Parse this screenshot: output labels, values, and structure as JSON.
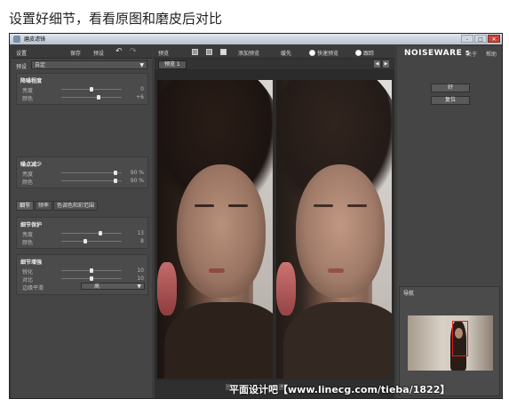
{
  "caption": "设置好细节，看看原图和磨皮后对比",
  "window": {
    "title": "磨皮滤镜",
    "min": "-",
    "max": "□",
    "close": "✕"
  },
  "left_panel": {
    "title": "设置",
    "save": "保存",
    "preset_btn": "预设",
    "undo_icon": "undo-icon",
    "redo_icon": "redo-icon",
    "preset_label": "预设",
    "preset_value": "自定",
    "noise_level": {
      "header": "降噪程度",
      "rows": [
        {
          "name": "亮度",
          "value": "0",
          "level": 0.5
        },
        {
          "name": "颜色",
          "value": "+6",
          "level": 0.62
        }
      ]
    },
    "noise_reduction": {
      "header": "噪点减少",
      "rows": [
        {
          "name": "亮度",
          "value": "90 %",
          "level": 0.9
        },
        {
          "name": "颜色",
          "value": "90 %",
          "level": 0.9
        }
      ]
    },
    "tabs": [
      "细节",
      "频率",
      "色调色和彩范围"
    ],
    "detail_protect": {
      "header": "细节保护",
      "rows": [
        {
          "name": "亮度",
          "value": "13",
          "level": 0.65
        },
        {
          "name": "颜色",
          "value": "8",
          "level": 0.4
        }
      ]
    },
    "detail_enhance": {
      "header": "细节增强",
      "rows": [
        {
          "name": "锐化",
          "value": "10",
          "level": 0.5
        },
        {
          "name": "对比",
          "value": "10",
          "level": 0.5
        }
      ],
      "edge_label": "边缘平滑",
      "edge_value": "高"
    }
  },
  "center_panel": {
    "title": "预览",
    "add_preview": "添加预览",
    "quick_preview": "快速预览",
    "sample": "缓先",
    "track": "跟踪",
    "tab": "预览 1"
  },
  "right_panel": {
    "logo_main": "NOISEWARE",
    "logo_ver": "5",
    "about": "关于",
    "help": "帮助",
    "ok": "好",
    "reset": "复位",
    "navigator": "导航"
  },
  "watermark": "平面设计吧【www.linecg.com/tieba/1822】"
}
